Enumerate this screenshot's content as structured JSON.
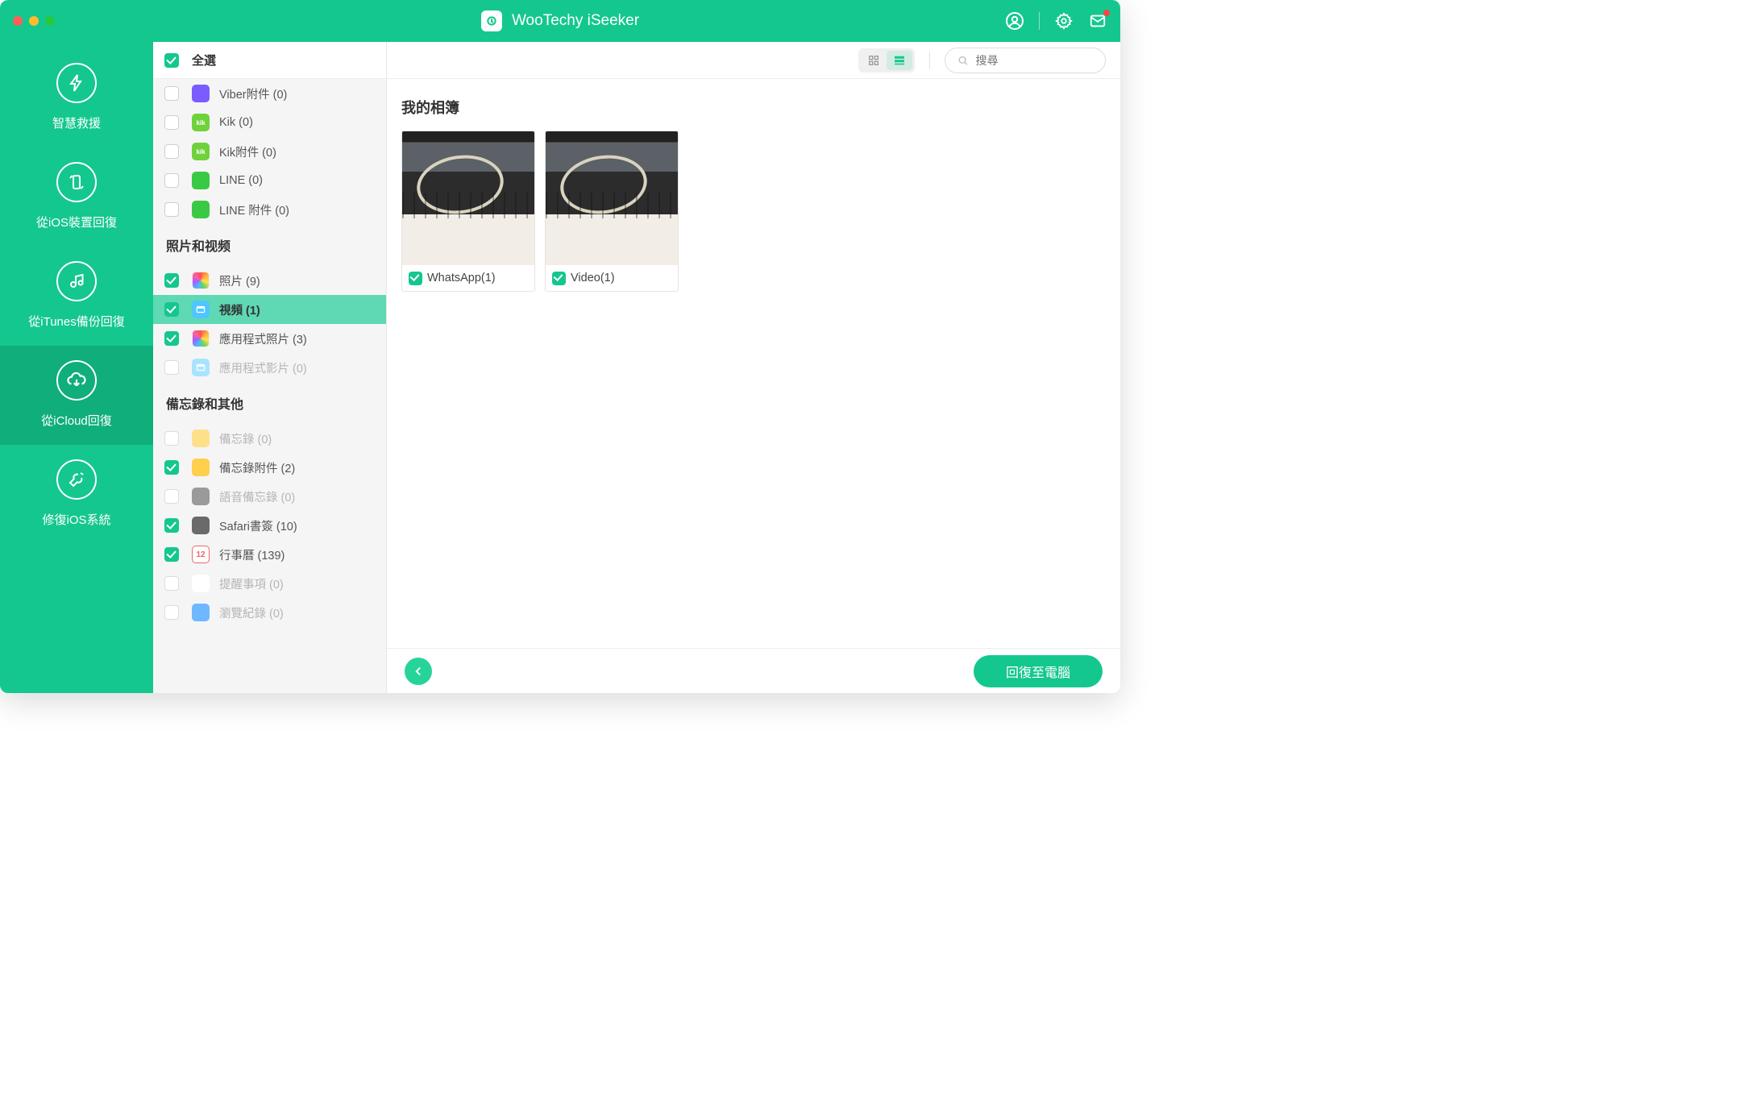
{
  "app": {
    "title": "WooTechy iSeeker"
  },
  "nav": {
    "items": [
      {
        "label": "智慧救援"
      },
      {
        "label": "從iOS裝置回復"
      },
      {
        "label": "從iTunes備份回復"
      },
      {
        "label": "從iCloud回復"
      },
      {
        "label": "修復iOS系統"
      }
    ],
    "activeIndex": 3
  },
  "categories": {
    "selectAll": "全選",
    "groups": [
      {
        "header": null,
        "items": [
          {
            "label": "Viber附件 (0)",
            "iconColor": "#7b5cff",
            "iconText": ""
          },
          {
            "label": "Kik (0)",
            "iconColor": "#6fd23c",
            "iconText": "kik"
          },
          {
            "label": "Kik附件 (0)",
            "iconColor": "#6fd23c",
            "iconText": "kik"
          },
          {
            "label": "LINE (0)",
            "iconColor": "#3ac945",
            "iconText": ""
          },
          {
            "label": "LINE 附件 (0)",
            "iconColor": "#3ac945",
            "iconText": ""
          }
        ]
      },
      {
        "header": "照片和视频",
        "items": [
          {
            "label": "照片 (9)",
            "checked": true,
            "iconColor": "#ffffff",
            "iconMulti": true
          },
          {
            "label": "視頻 (1)",
            "checked": true,
            "selected": true,
            "iconColor": "#4fc6ff",
            "iconClap": true
          },
          {
            "label": "應用程式照片 (3)",
            "checked": true,
            "iconColor": "#ffffff",
            "iconMulti": true
          },
          {
            "label": "應用程式影片 (0)",
            "iconColor": "#a9e4ff",
            "iconClap": true,
            "disabled": true
          }
        ]
      },
      {
        "header": "備忘錄和其他",
        "items": [
          {
            "label": "備忘錄 (0)",
            "disabled": true,
            "iconColor": "#ffe08a"
          },
          {
            "label": "備忘錄附件 (2)",
            "checked": true,
            "iconColor": "#ffcf4d"
          },
          {
            "label": "語音備忘錄 (0)",
            "disabled": true,
            "iconColor": "#9a9a9a"
          },
          {
            "label": "Safari書簽 (10)",
            "checked": true,
            "iconColor": "#6a6a6a"
          },
          {
            "label": "行事曆 (139)",
            "checked": true,
            "iconColor": "#ffffff",
            "iconCal": true
          },
          {
            "label": "提醒事項 (0)",
            "disabled": true,
            "iconColor": "#ffffff"
          },
          {
            "label": "瀏覽紀錄 (0)",
            "disabled": true,
            "iconColor": "#6fb8ff"
          }
        ]
      }
    ]
  },
  "content": {
    "sectionTitle": "我的相簿",
    "search": {
      "placeholder": "搜尋"
    },
    "albums": [
      {
        "label": "WhatsApp(1)"
      },
      {
        "label": "Video(1)"
      }
    ]
  },
  "footer": {
    "recoverLabel": "回復至電腦"
  }
}
